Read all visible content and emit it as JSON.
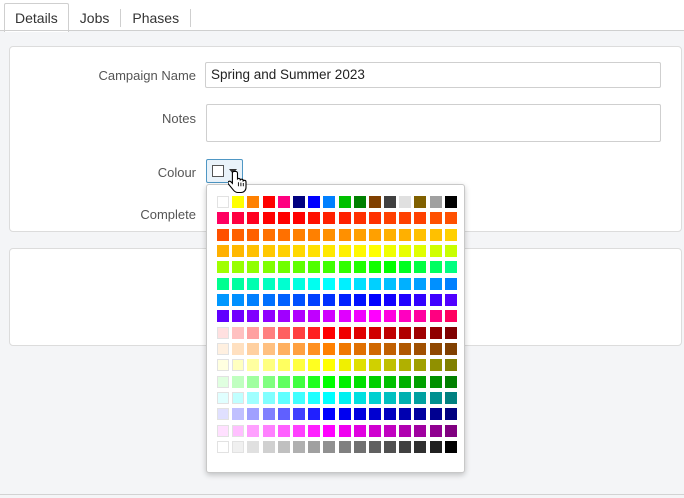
{
  "tabs": [
    {
      "label": "Details",
      "active": true
    },
    {
      "label": "Jobs",
      "active": false
    },
    {
      "label": "Phases",
      "active": false
    }
  ],
  "form": {
    "campaign_name_label": "Campaign Name",
    "campaign_name_value": "Spring and Summer 2023",
    "notes_label": "Notes",
    "notes_value": "",
    "colour_label": "Colour",
    "complete_label": "Complete"
  },
  "colour_picker": {
    "selected": "#ffffff",
    "palette": [
      [
        "#ffffff",
        "#ffff00",
        "#ff8000",
        "#ff0000",
        "#ff0080",
        "#000080",
        "#0000ff",
        "#0080ff",
        "#00c000",
        "#008000",
        "#804000",
        "#404040",
        "#e0e0e0",
        "#806000",
        "#a0a0a0",
        "#000000"
      ],
      [
        "#ff0060",
        "#ff0040",
        "#ff0020",
        "#ff0000",
        "#ff0000",
        "#ff0000",
        "#ff1000",
        "#ff2000",
        "#ff2000",
        "#ff3000",
        "#ff3000",
        "#ff4000",
        "#ff4000",
        "#ff4000",
        "#ff5000",
        "#ff5000"
      ],
      [
        "#ff5000",
        "#ff6000",
        "#ff6000",
        "#ff7000",
        "#ff7000",
        "#ff8000",
        "#ff8000",
        "#ff9000",
        "#ff9000",
        "#ffa000",
        "#ffa000",
        "#ffb000",
        "#ffb000",
        "#ffc000",
        "#ffc000",
        "#ffd000"
      ],
      [
        "#ffb000",
        "#ffb800",
        "#ffc000",
        "#ffc800",
        "#ffd000",
        "#ffd800",
        "#ffe000",
        "#ffe800",
        "#fff000",
        "#fff800",
        "#ffff00",
        "#f0ff00",
        "#e8ff00",
        "#e0ff00",
        "#d0ff00",
        "#c8ff00"
      ],
      [
        "#a0ff00",
        "#98ff00",
        "#90ff00",
        "#80ff00",
        "#70ff00",
        "#60ff00",
        "#50ff00",
        "#40ff00",
        "#30ff00",
        "#20ff00",
        "#10ff00",
        "#00ff00",
        "#00ff20",
        "#00ff40",
        "#00ff60",
        "#00ff80"
      ],
      [
        "#00ff90",
        "#00ffa0",
        "#00ffb0",
        "#00ffc0",
        "#00ffd0",
        "#00ffe0",
        "#00fff0",
        "#00ffff",
        "#00f0ff",
        "#00e0ff",
        "#00d0ff",
        "#00c0ff",
        "#00b0ff",
        "#00a0ff",
        "#0090ff",
        "#0080ff"
      ],
      [
        "#0098ff",
        "#0090ff",
        "#0080ff",
        "#0070ff",
        "#0060ff",
        "#0050ff",
        "#0040ff",
        "#0030ff",
        "#0020ff",
        "#0010ff",
        "#0000ff",
        "#1000ff",
        "#2000ff",
        "#3000ff",
        "#4000ff",
        "#5000ff"
      ],
      [
        "#6000ff",
        "#7000ff",
        "#8000ff",
        "#9000ff",
        "#a000ff",
        "#b000ff",
        "#c000ff",
        "#d000ff",
        "#e000ff",
        "#f000ff",
        "#ff00ff",
        "#ff00e0",
        "#ff00c0",
        "#ff00a0",
        "#ff0080",
        "#ff0060"
      ],
      [
        "#ffe0e0",
        "#ffc0c0",
        "#ffa0a0",
        "#ff8080",
        "#ff6060",
        "#ff4040",
        "#ff2020",
        "#ff0000",
        "#f00000",
        "#e00000",
        "#d00000",
        "#c00000",
        "#b00000",
        "#a00000",
        "#900000",
        "#800000"
      ],
      [
        "#fff0e0",
        "#ffe0c0",
        "#ffd0a0",
        "#ffc080",
        "#ffb060",
        "#ffa040",
        "#ff9020",
        "#ff8000",
        "#f07800",
        "#e07000",
        "#d06800",
        "#c06000",
        "#b05800",
        "#a05000",
        "#904800",
        "#804000"
      ],
      [
        "#ffffe0",
        "#ffffc0",
        "#ffffa0",
        "#ffff80",
        "#ffff60",
        "#ffff40",
        "#ffff20",
        "#ffff00",
        "#f0f000",
        "#e0e000",
        "#d0d000",
        "#c0c000",
        "#b0b000",
        "#a0a000",
        "#909000",
        "#808000"
      ],
      [
        "#e0ffe0",
        "#c0ffc0",
        "#a0ffa0",
        "#80ff80",
        "#60ff60",
        "#40ff40",
        "#20ff20",
        "#00ff00",
        "#00f000",
        "#00e000",
        "#00d000",
        "#00c000",
        "#00b000",
        "#00a000",
        "#009000",
        "#008000"
      ],
      [
        "#e0ffff",
        "#c0ffff",
        "#a0ffff",
        "#80ffff",
        "#60ffff",
        "#40ffff",
        "#20ffff",
        "#00ffff",
        "#00f0f0",
        "#00e0e0",
        "#00d0d0",
        "#00c0c0",
        "#00b0b0",
        "#00a0a0",
        "#009090",
        "#008080"
      ],
      [
        "#e0e0ff",
        "#c0c0ff",
        "#a0a0ff",
        "#8080ff",
        "#6060ff",
        "#4040ff",
        "#2020ff",
        "#0000ff",
        "#0000f0",
        "#0000e0",
        "#0000d0",
        "#0000c0",
        "#0000b0",
        "#0000a0",
        "#000090",
        "#000080"
      ],
      [
        "#ffe0ff",
        "#ffc0ff",
        "#ffa0ff",
        "#ff80ff",
        "#ff60ff",
        "#ff40ff",
        "#ff20ff",
        "#ff00ff",
        "#f000f0",
        "#e000e0",
        "#d000d0",
        "#c000c0",
        "#b000b0",
        "#a000a0",
        "#900090",
        "#800080"
      ],
      [
        "#ffffff",
        "#f0f0f0",
        "#e0e0e0",
        "#d0d0d0",
        "#c0c0c0",
        "#b0b0b0",
        "#a0a0a0",
        "#909090",
        "#808080",
        "#707070",
        "#606060",
        "#505050",
        "#404040",
        "#303030",
        "#202020",
        "#000000"
      ]
    ]
  }
}
